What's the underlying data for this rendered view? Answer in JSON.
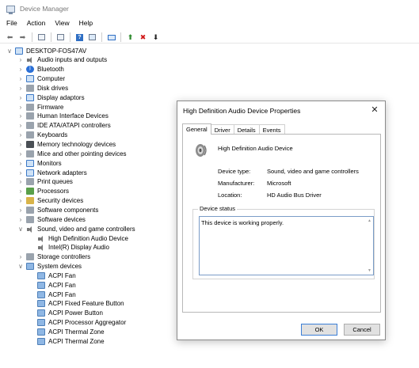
{
  "window": {
    "title": "Device Manager",
    "menu": [
      "File",
      "Action",
      "View",
      "Help"
    ],
    "toolbar_icons": [
      "back-arrow-icon",
      "forward-arrow-icon",
      "properties-icon",
      "show-hidden-icon",
      "help-icon",
      "grid-view-icon",
      "monitor-icon",
      "add-driver-icon",
      "uninstall-icon",
      "download-icon"
    ]
  },
  "tree": {
    "root": "DESKTOP-FOS47AV",
    "items": [
      {
        "label": "Audio inputs and outputs",
        "icon": "speaker",
        "expander": "›"
      },
      {
        "label": "Bluetooth",
        "icon": "bt",
        "expander": "›"
      },
      {
        "label": "Computer",
        "icon": "computer",
        "expander": "›"
      },
      {
        "label": "Disk drives",
        "icon": "gray",
        "expander": "›"
      },
      {
        "label": "Display adaptors",
        "icon": "computer",
        "expander": "›"
      },
      {
        "label": "Firmware",
        "icon": "gray",
        "expander": "›"
      },
      {
        "label": "Human Interface Devices",
        "icon": "gray",
        "expander": "›"
      },
      {
        "label": "IDE ATA/ATAPI controllers",
        "icon": "gray",
        "expander": "›"
      },
      {
        "label": "Keyboards",
        "icon": "gray",
        "expander": "›"
      },
      {
        "label": "Memory technology devices",
        "icon": "dark",
        "expander": "›"
      },
      {
        "label": "Mice and other pointing devices",
        "icon": "gray",
        "expander": "›"
      },
      {
        "label": "Monitors",
        "icon": "computer",
        "expander": "›"
      },
      {
        "label": "Network adapters",
        "icon": "computer",
        "expander": "›"
      },
      {
        "label": "Print queues",
        "icon": "gray",
        "expander": "›"
      },
      {
        "label": "Processors",
        "icon": "green",
        "expander": "›"
      },
      {
        "label": "Security devices",
        "icon": "yellow",
        "expander": "›"
      },
      {
        "label": "Software components",
        "icon": "gray",
        "expander": "›"
      },
      {
        "label": "Software devices",
        "icon": "gray",
        "expander": "›"
      },
      {
        "label": "Sound, video and game controllers",
        "icon": "speaker",
        "expander": "∨"
      },
      {
        "label": "High Definition Audio Device",
        "icon": "speaker",
        "expander": "",
        "child": true
      },
      {
        "label": "Intel(R) Display Audio",
        "icon": "speaker",
        "expander": "",
        "child": true
      },
      {
        "label": "Storage controllers",
        "icon": "gray",
        "expander": "›"
      },
      {
        "label": "System devices",
        "icon": "lblue",
        "expander": "∨"
      },
      {
        "label": "ACPI Fan",
        "icon": "lblue",
        "expander": "",
        "child": true
      },
      {
        "label": "ACPI Fan",
        "icon": "lblue",
        "expander": "",
        "child": true
      },
      {
        "label": "ACPI Fan",
        "icon": "lblue",
        "expander": "",
        "child": true
      },
      {
        "label": "ACPI Fixed Feature Button",
        "icon": "lblue",
        "expander": "",
        "child": true
      },
      {
        "label": "ACPI Power Button",
        "icon": "lblue",
        "expander": "",
        "child": true
      },
      {
        "label": "ACPI Processor Aggregator",
        "icon": "lblue",
        "expander": "",
        "child": true
      },
      {
        "label": "ACPI Thermal Zone",
        "icon": "lblue",
        "expander": "",
        "child": true
      },
      {
        "label": "ACPI Thermal Zone",
        "icon": "lblue",
        "expander": "",
        "child": true
      }
    ]
  },
  "dialog": {
    "title": "High Definition Audio Device Properties",
    "close": "✕",
    "tabs": [
      "General",
      "Driver",
      "Details",
      "Events"
    ],
    "active_tab": "General",
    "device_name": "High Definition Audio Device",
    "properties": [
      {
        "label": "Device type:",
        "value": "Sound, video and game controllers"
      },
      {
        "label": "Manufacturer:",
        "value": "Microsoft"
      },
      {
        "label": "Location:",
        "value": "HD Audio Bus Driver"
      }
    ],
    "status_group": "Device status",
    "status_text": "This device is working properly.",
    "ok": "OK",
    "cancel": "Cancel"
  }
}
